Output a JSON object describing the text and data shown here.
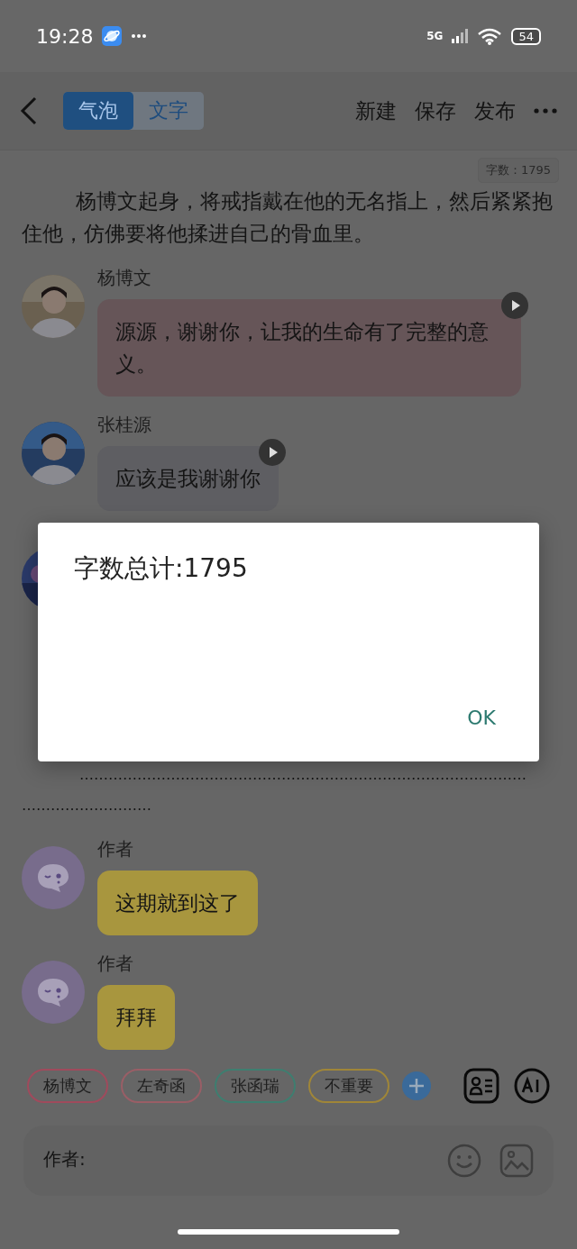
{
  "status_bar": {
    "time": "19:28",
    "network": "5G",
    "battery": "54"
  },
  "header": {
    "tabs": [
      {
        "label": "气泡",
        "selected": true
      },
      {
        "label": "文字",
        "selected": false
      }
    ],
    "actions": [
      "新建",
      "保存",
      "发布"
    ]
  },
  "word_count_badge": "字数：1795",
  "narration": "杨博文起身，将戒指戴在他的无名指上，然后紧紧抱住他，仿佛要将他揉进自己的骨血里。",
  "messages": [
    {
      "speaker": "杨博文",
      "text": "源源，谢谢你，让我的生命有了完整的意义。",
      "color": "#665558",
      "voice": true
    },
    {
      "speaker": "张桂源",
      "text": "应该是我谢谢你",
      "color": "#5e5e62",
      "voice": true
    }
  ],
  "ellipsis": "…………………………………………………………………………………………………………",
  "author_messages": [
    {
      "speaker": "作者",
      "text": "这期就到这了",
      "color": "#a8963e",
      "voice": false
    },
    {
      "speaker": "作者",
      "text": "拜拜",
      "color": "#a8963e",
      "voice": false
    }
  ],
  "chips": [
    {
      "label": "杨博文",
      "color": "#a04a5c"
    },
    {
      "label": "左奇函",
      "color": "#9a5e66"
    },
    {
      "label": "张函瑞",
      "color": "#3e7e70"
    },
    {
      "label": "不重要",
      "color": "#a08638"
    }
  ],
  "composer": {
    "prefix": "作者:"
  },
  "dialog": {
    "message": "字数总计:1795",
    "button": "OK"
  }
}
